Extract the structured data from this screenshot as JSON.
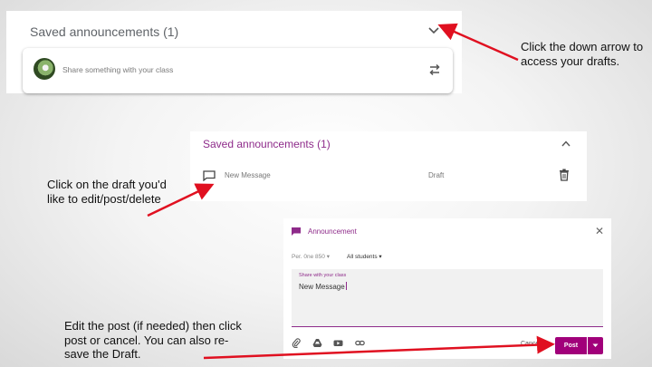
{
  "panel1": {
    "title": "Saved announcements (1)",
    "share_placeholder": "Share something with your class",
    "icons": [
      "chevron-down-icon",
      "swap-icon"
    ]
  },
  "panel2": {
    "title": "Saved announcements (1)",
    "draft_name": "New Message",
    "draft_status": "Draft",
    "icons": [
      "chevron-up-icon",
      "announcement-icon",
      "trash-icon"
    ]
  },
  "panel3": {
    "header": "Announcement",
    "course": "Per. 0ne 850",
    "students": "All students",
    "prompt_label": "Share with your class",
    "message": "New Message",
    "cancel_label": "Cancel",
    "post_label": "Post",
    "icons": [
      "close-icon",
      "paperclip-icon",
      "drive-icon",
      "youtube-icon",
      "link-icon",
      "dropdown-icon"
    ]
  },
  "callouts": {
    "down_arrow": "Click the down arrow to access your drafts.",
    "draft": "Click on the draft you'd like to edit/post/delete",
    "edit": "Edit the post (if needed) then click post or cancel. You can also re-save the Draft."
  },
  "colors": {
    "accent": "#8e2b8a",
    "post_button": "#a1007a",
    "arrow": "#e01020"
  }
}
